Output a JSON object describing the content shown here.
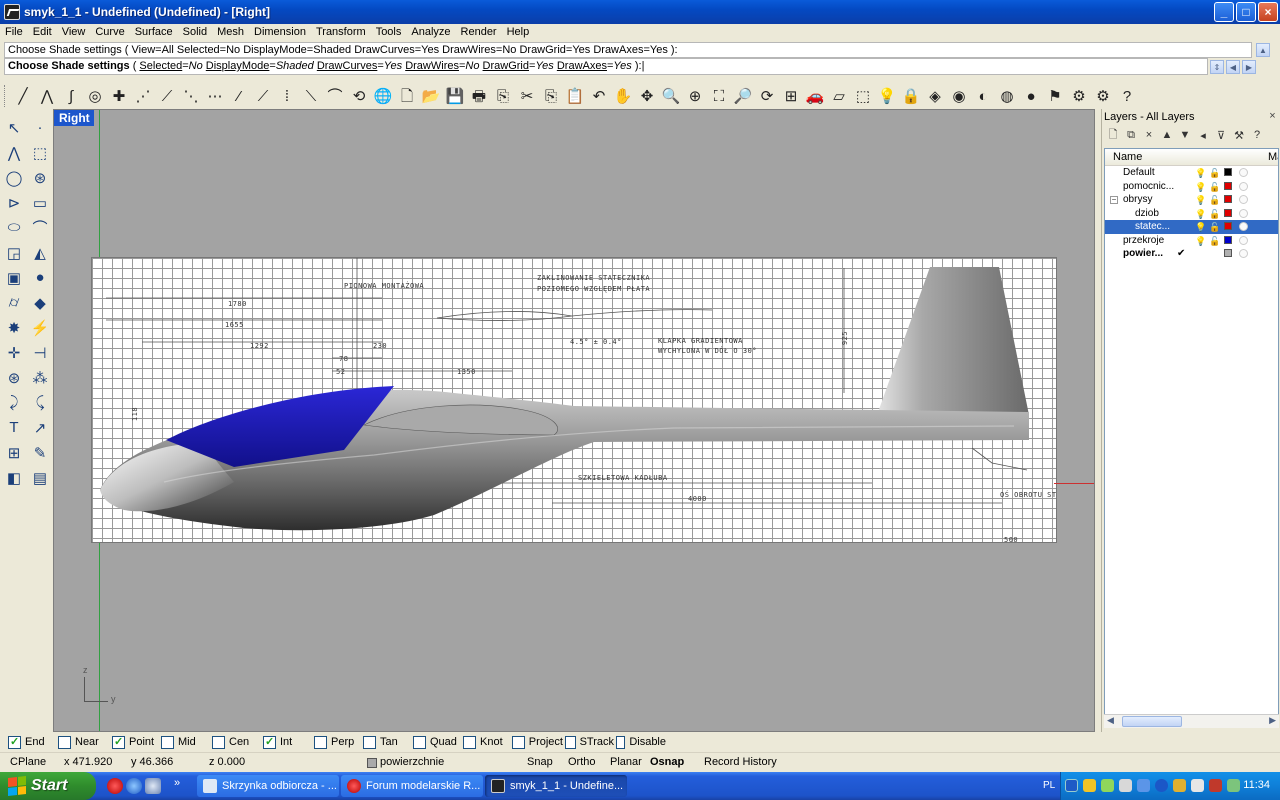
{
  "window": {
    "title": "smyk_1_1 - Undefined (Undefined) - [Right]",
    "controls": {
      "minimize": "_",
      "maximize": "□",
      "close": "×"
    }
  },
  "menu": [
    "File",
    "Edit",
    "View",
    "Curve",
    "Surface",
    "Solid",
    "Mesh",
    "Dimension",
    "Transform",
    "Tools",
    "Analyze",
    "Render",
    "Help"
  ],
  "command": {
    "history": "Choose Shade settings ( View=All  Selected=No  DisplayMode=Shaded  DrawCurves=Yes  DrawWires=No  DrawGrid=Yes  DrawAxes=Yes ):",
    "prompt_bold": "Choose Shade settings",
    "p1": " ( ",
    "k1": "Selected",
    "e1": "=",
    "v1": "No",
    "k2": "DisplayMode",
    "v2": "Shaded",
    "k3": "DrawCurves",
    "v3": "Yes",
    "k4": "DrawWires",
    "v4": "No",
    "k5": "DrawGrid",
    "v5": "Yes",
    "k6": "DrawAxes",
    "v6": "Yes",
    "tail": " ):"
  },
  "top_toolbar_icons": [
    {
      "name": "line-icon",
      "glyph": "╱"
    },
    {
      "name": "polyline-icon",
      "glyph": "⋀"
    },
    {
      "name": "curve-icon",
      "glyph": "∫"
    },
    {
      "name": "circle-point-icon",
      "glyph": "◎"
    },
    {
      "name": "snap-point-icon",
      "glyph": "✚"
    },
    {
      "name": "control-point-curve-icon",
      "glyph": "⋰"
    },
    {
      "name": "point-on-curve-icon",
      "glyph": "⟋"
    },
    {
      "name": "interpolate-icon",
      "glyph": "⋱"
    },
    {
      "name": "dash-icon",
      "glyph": "⋯"
    },
    {
      "name": "segment-icon",
      "glyph": "⁄"
    },
    {
      "name": "diagonal-icon",
      "glyph": "⟋"
    },
    {
      "name": "vertical-icon",
      "glyph": "⁞"
    },
    {
      "name": "trim-icon",
      "glyph": "⟍"
    },
    {
      "name": "arc-icon",
      "glyph": "⌒"
    },
    {
      "name": "rotate-shape-icon",
      "glyph": "⟲"
    },
    {
      "name": "globe-icon",
      "glyph": "🌐"
    },
    {
      "name": "new-file-icon",
      "glyph": "🗋"
    },
    {
      "name": "open-folder-icon",
      "glyph": "📂"
    },
    {
      "name": "save-icon",
      "glyph": "💾"
    },
    {
      "name": "print-icon",
      "glyph": "🖶"
    },
    {
      "name": "export-icon",
      "glyph": "⎘"
    },
    {
      "name": "cut-icon",
      "glyph": "✂"
    },
    {
      "name": "copy-icon",
      "glyph": "⎘"
    },
    {
      "name": "paste-icon",
      "glyph": "📋"
    },
    {
      "name": "undo-icon",
      "glyph": "↶"
    },
    {
      "name": "pan-hand-icon",
      "glyph": "✋"
    },
    {
      "name": "rotate-view-icon",
      "glyph": "✥"
    },
    {
      "name": "zoom-dynamic-icon",
      "glyph": "🔍"
    },
    {
      "name": "zoom-window-icon",
      "glyph": "⊕"
    },
    {
      "name": "zoom-extents-icon",
      "glyph": "⛶"
    },
    {
      "name": "zoom-selected-icon",
      "glyph": "🔎"
    },
    {
      "name": "zoom-undo-icon",
      "glyph": "⟳"
    },
    {
      "name": "four-viewports-icon",
      "glyph": "⊞"
    },
    {
      "name": "car-icon",
      "glyph": "🚗"
    },
    {
      "name": "cplane-icon",
      "glyph": "▱"
    },
    {
      "name": "select-icon",
      "glyph": "⬚"
    },
    {
      "name": "lightbulb-icon",
      "glyph": "💡"
    },
    {
      "name": "lock-icon",
      "glyph": "🔒"
    },
    {
      "name": "layers-icon",
      "glyph": "◈"
    },
    {
      "name": "color-wheel-icon",
      "glyph": "◉"
    },
    {
      "name": "shade-sphere-icon",
      "glyph": "◐"
    },
    {
      "name": "render-sphere-icon",
      "glyph": "◍"
    },
    {
      "name": "render-blue-sphere-icon",
      "glyph": "●"
    },
    {
      "name": "flag-icon",
      "glyph": "⚑"
    },
    {
      "name": "gear-icon",
      "glyph": "⚙"
    },
    {
      "name": "options-icon",
      "glyph": "⚙"
    },
    {
      "name": "help-icon",
      "glyph": "?"
    }
  ],
  "left_toolbar_icons": [
    {
      "name": "select-arrow-icon",
      "glyph": "↖"
    },
    {
      "name": "point-icon",
      "glyph": "·"
    },
    {
      "name": "polyline-tool-icon",
      "glyph": "⋀"
    },
    {
      "name": "polygon-icon",
      "glyph": "⬚"
    },
    {
      "name": "circle-tool-icon",
      "glyph": "◯"
    },
    {
      "name": "circle-move-icon",
      "glyph": "⊛"
    },
    {
      "name": "arc-tool-icon",
      "glyph": "⊳"
    },
    {
      "name": "rectangle-icon",
      "glyph": "▭"
    },
    {
      "name": "ellipse-icon",
      "glyph": "⬭"
    },
    {
      "name": "fillet-icon",
      "glyph": "⌒"
    },
    {
      "name": "extrude-icon",
      "glyph": "◲"
    },
    {
      "name": "loft-icon",
      "glyph": "◭"
    },
    {
      "name": "box-icon",
      "glyph": "▣"
    },
    {
      "name": "sphere-icon",
      "glyph": "●"
    },
    {
      "name": "cylinder-icon",
      "glyph": "⌭"
    },
    {
      "name": "mesh-icon",
      "glyph": "◆"
    },
    {
      "name": "explode-icon",
      "glyph": "✸"
    },
    {
      "name": "boolean-icon",
      "glyph": "⚡"
    },
    {
      "name": "move-icon",
      "glyph": "✛"
    },
    {
      "name": "transform-icon",
      "glyph": "⊣"
    },
    {
      "name": "boolean-union-icon",
      "glyph": "⊛"
    },
    {
      "name": "boolean-split-icon",
      "glyph": "⁂"
    },
    {
      "name": "offset-icon",
      "glyph": "⤸"
    },
    {
      "name": "blend-icon",
      "glyph": "⤹"
    },
    {
      "name": "text-icon",
      "glyph": "T"
    },
    {
      "name": "dimension-icon",
      "glyph": "↗"
    },
    {
      "name": "array-icon",
      "glyph": "⊞"
    },
    {
      "name": "pencil-icon",
      "glyph": "✎"
    },
    {
      "name": "cube-view-icon",
      "glyph": "◧"
    },
    {
      "name": "hatch-icon",
      "glyph": "▤"
    }
  ],
  "viewport": {
    "label": "Right",
    "axis_z": "z",
    "axis_y": "y",
    "drawing_labels": {
      "pionowa": "PIONOWA MONTAŻOWA",
      "zaklinowanie1": "ZAKLINOWANIE STATECZNIKA",
      "zaklinowanie2": "POZIOMEGO WZGLĘDEM PŁATA",
      "klapka1": "KLAPKA GRADIENTOWA",
      "klapka2": "WYCHYLONA W DÓŁ O 30°",
      "kat": "4.5° ± 0.4°",
      "szkieletowa": "SZKIELETOWA KADŁUBA",
      "obrotu": "OŚ OBROTU ST",
      "d1780": "1780",
      "d1655": "1655",
      "d1292": "1292",
      "d230": "230",
      "d78": "78",
      "d52": "52",
      "d1350": "1350",
      "d925": "925",
      "d4000": "4000",
      "d500": "500",
      "d118": "118"
    }
  },
  "layers": {
    "title": "Layers - All Layers",
    "close": "×",
    "toolbar": [
      "🗋",
      "⧉",
      "×",
      "▲",
      "▼",
      "◂",
      "⊽",
      "⚒",
      "?"
    ],
    "col_name": "Name",
    "col_mat": "Mate",
    "rows": [
      {
        "name": "Default",
        "color": "#000000",
        "indent": 1,
        "selected": false,
        "current": false,
        "tree": ""
      },
      {
        "name": "pomocnic...",
        "color": "#e00000",
        "indent": 1,
        "selected": false,
        "current": false,
        "tree": ""
      },
      {
        "name": "obrysy",
        "color": "#e00000",
        "indent": 1,
        "selected": false,
        "current": false,
        "tree": "−"
      },
      {
        "name": "dziob",
        "color": "#e00000",
        "indent": 2,
        "selected": false,
        "current": false,
        "tree": ""
      },
      {
        "name": "statec...",
        "color": "#e00000",
        "indent": 2,
        "selected": true,
        "current": false,
        "tree": ""
      },
      {
        "name": "przekroje",
        "color": "#0000cc",
        "indent": 1,
        "selected": false,
        "current": false,
        "tree": ""
      },
      {
        "name": "powier...",
        "color": "#b0b0b0",
        "indent": 1,
        "selected": false,
        "current": true,
        "tree": ""
      }
    ],
    "current_mark": "✔"
  },
  "osnap": [
    {
      "label": "End",
      "on": true
    },
    {
      "label": "Near",
      "on": false
    },
    {
      "label": "Point",
      "on": true
    },
    {
      "label": "Mid",
      "on": false
    },
    {
      "label": "Cen",
      "on": false
    },
    {
      "label": "Int",
      "on": true
    },
    {
      "label": "Perp",
      "on": false
    },
    {
      "label": "Tan",
      "on": false
    },
    {
      "label": "Quad",
      "on": false
    },
    {
      "label": "Knot",
      "on": false
    },
    {
      "label": "Project",
      "on": false
    },
    {
      "label": "STrack",
      "on": false
    },
    {
      "label": "Disable",
      "on": false
    }
  ],
  "status": {
    "cplane": "CPlane",
    "x": "x 471.920",
    "y": "y 46.366",
    "z": "z 0.000",
    "layer": "powierzchnie",
    "snap": "Snap",
    "ortho": "Ortho",
    "planar": "Planar",
    "osnap": "Osnap",
    "record": "Record History"
  },
  "taskbar": {
    "start": "Start",
    "more": "»",
    "tasks": [
      {
        "label": "Skrzynka odbiorcza - ...",
        "active": false
      },
      {
        "label": "Forum modelarskie R...",
        "active": false
      },
      {
        "label": "smyk_1_1 - Undefine...",
        "active": true
      }
    ],
    "lang": "PL",
    "clock": "11:34"
  },
  "colors": {
    "viewport_bg": "#a3a3a3",
    "canopy": "#1c17b8",
    "fuselage": "#8a8a8a",
    "selection": "#316ac5"
  }
}
